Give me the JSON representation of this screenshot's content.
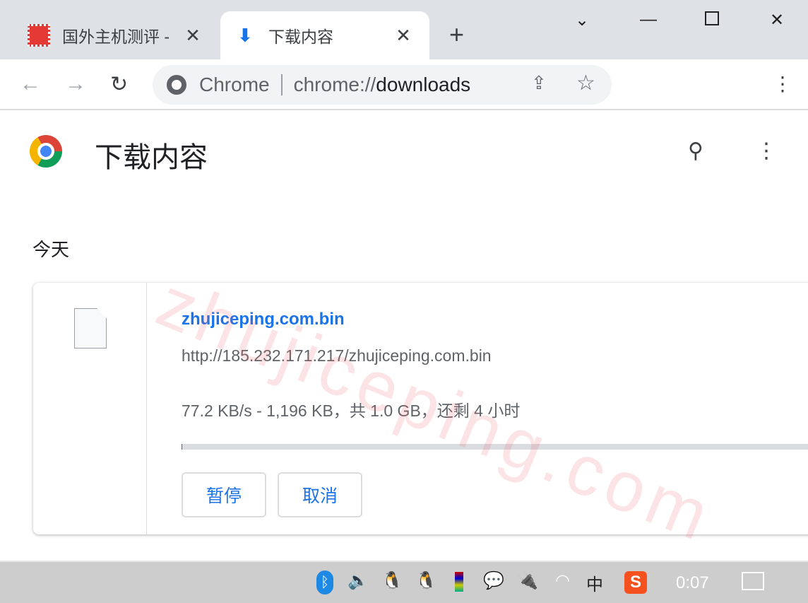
{
  "tabs": [
    {
      "title": "国外主机测评 - ",
      "icon": "site-favicon",
      "active": false
    },
    {
      "title": "下载内容",
      "icon": "download-icon",
      "active": true
    }
  ],
  "omnibox": {
    "chip": "Chrome",
    "scheme": "chrome://",
    "host": "downloads"
  },
  "page": {
    "title": "下载内容",
    "section": "今天"
  },
  "download": {
    "filename": "zhujiceping.com.bin",
    "url": "http://185.232.171.217/zhujiceping.com.bin",
    "status": "77.2 KB/s - 1,196 KB，共 1.0 GB，还剩 4 小时",
    "progress_percent": 0.1,
    "pause_label": "暂停",
    "cancel_label": "取消"
  },
  "watermark": "zhujiceping.com",
  "taskbar": {
    "clock": "0:07",
    "ime": "中"
  },
  "colors": {
    "accent": "#1a73e8",
    "tabbar": "#dee1e6"
  }
}
